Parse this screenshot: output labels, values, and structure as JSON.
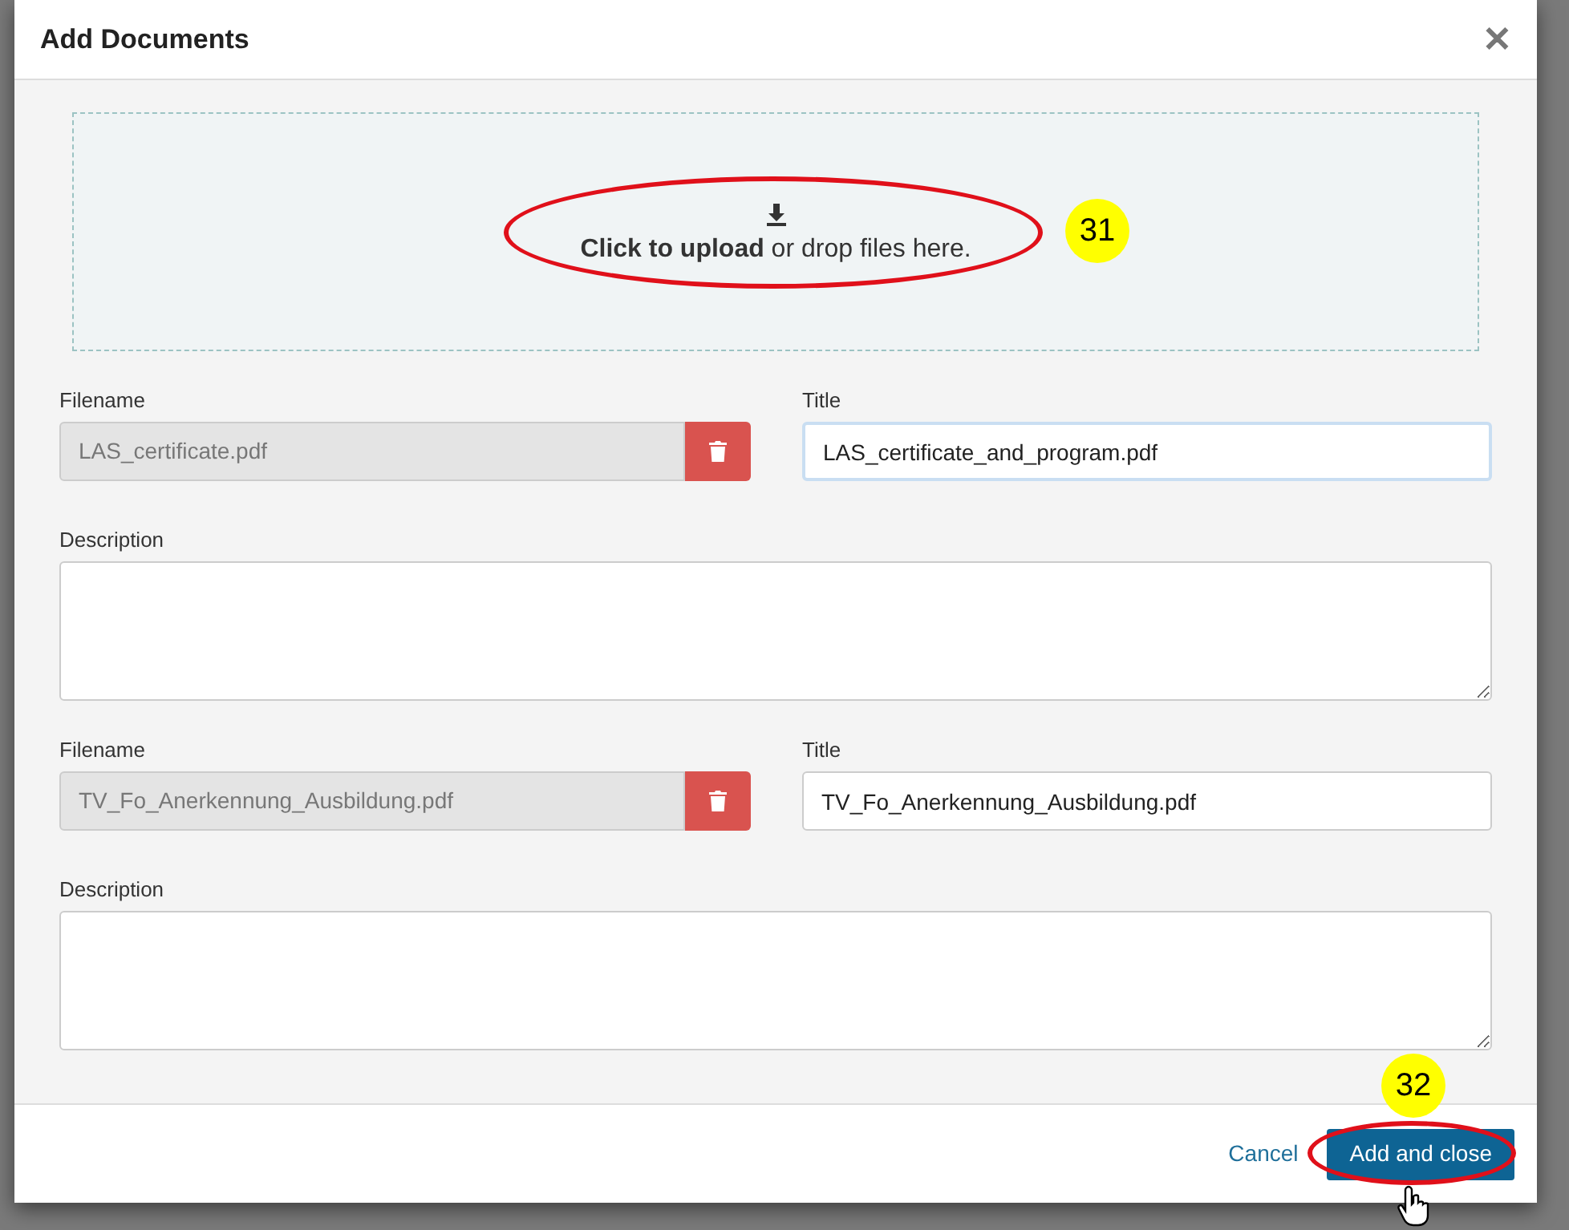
{
  "dialog": {
    "title": "Add Documents",
    "close": "✕"
  },
  "dropzone": {
    "text": "**Click to upload** or drop files here.",
    "annotation": "31"
  },
  "documents": [
    {
      "filename_label": "Filename",
      "filename": "LAS_certificate.pdf",
      "title_label": "Title",
      "title": "LAS_certificate_and_program.pdf",
      "title_focused": true,
      "description_label": "Description"
    },
    {
      "filename_label": "Filename",
      "filename": "TV_Fo_Anerkennung_Ausbildung.pdf",
      "title_label": "Title",
      "title": "TV_Fo_Anerkennung_Ausbildung.pdf",
      "title_focused": false,
      "description_label": "Description"
    }
  ],
  "footer": {
    "cancel": "Cancel",
    "submit": "Add and close",
    "annotation": "32"
  }
}
